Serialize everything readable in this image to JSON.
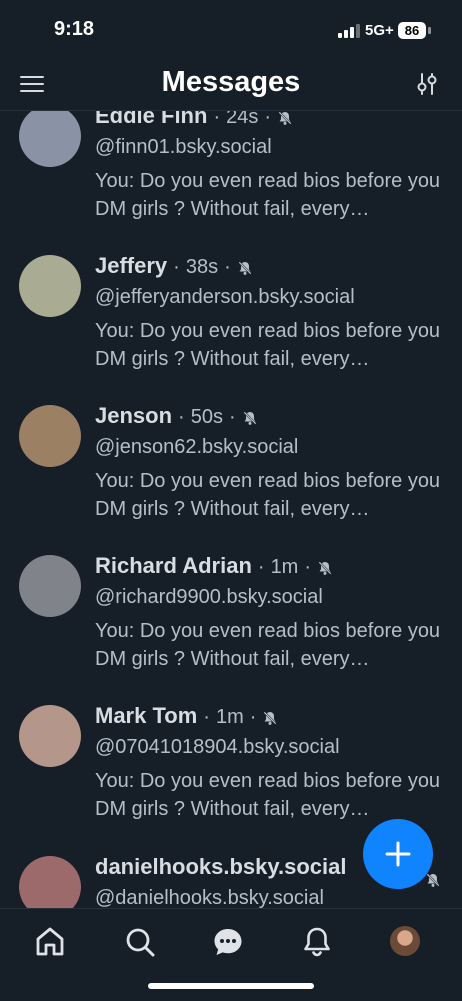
{
  "status_bar": {
    "time": "9:18",
    "network": "5G+",
    "battery": "86"
  },
  "header": {
    "title": "Messages",
    "menu_icon": "hamburger-menu-icon",
    "filter_icon": "sliders-icon"
  },
  "conversations": [
    {
      "name": "Eddie Finn",
      "time": "24s",
      "handle": "@finn01.bsky.social",
      "preview": "You: Do you even read bios before you DM girls ? Without fail, every…",
      "muted": true,
      "avatar_color": "#8a93a5"
    },
    {
      "name": "Jeffery",
      "time": "38s",
      "handle": "@jefferyanderson.bsky.social",
      "preview": "You: Do you even read bios before you DM girls ? Without fail, every…",
      "muted": true,
      "avatar_color": "#a9ab92"
    },
    {
      "name": "Jenson",
      "time": "50s",
      "handle": "@jenson62.bsky.social",
      "preview": "You: Do you even read bios before you DM girls ? Without fail, every…",
      "muted": true,
      "avatar_color": "#9b8064"
    },
    {
      "name": "Richard Adrian",
      "time": "1m",
      "handle": "@richard9900.bsky.social",
      "preview": "You: Do you even read bios before you DM girls ? Without fail, every…",
      "muted": true,
      "avatar_color": "#808389"
    },
    {
      "name": "Mark Tom",
      "time": "1m",
      "handle": "@07041018904.bsky.social",
      "preview": "You: Do you even read bios before you DM girls ? Without fail, every…",
      "muted": true,
      "avatar_color": "#b4968a"
    },
    {
      "name": "danielhooks.bsky.social",
      "time": "",
      "handle": "@danielhooks.bsky.social",
      "preview": "",
      "muted": true,
      "avatar_color": "#9d6a6c"
    }
  ],
  "fab": {
    "icon": "plus-icon",
    "color": "#1083fe"
  },
  "tab_bar": {
    "items": [
      "home-icon",
      "search-icon",
      "chat-bubble-icon",
      "bell-icon",
      "profile-avatar"
    ]
  }
}
